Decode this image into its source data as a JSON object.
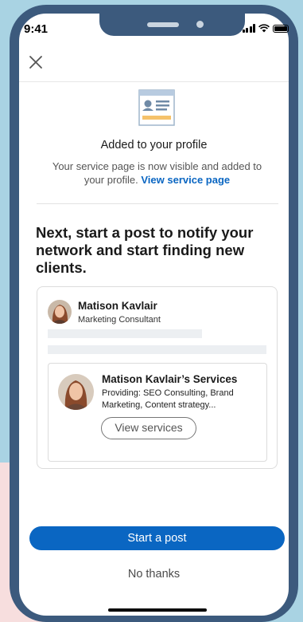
{
  "status_bar": {
    "time": "9:41"
  },
  "header": {
    "close_icon": "close-icon"
  },
  "confirmation": {
    "icon": "profile-card-icon",
    "title": "Added to your profile",
    "description": "Your service page is now visible and added to your profile.",
    "link": "View service page"
  },
  "headline": "Next, start a post to notify your network and start finding new clients.",
  "post_preview": {
    "author_name": "Matison Kavlair",
    "author_title": "Marketing Consultant",
    "service": {
      "title": "Matison Kavlair’s Services",
      "description": "Providing: SEO Consulting, Brand Marketing, Content strategy...",
      "button": "View services"
    }
  },
  "actions": {
    "primary": "Start a post",
    "secondary": "No thanks"
  },
  "colors": {
    "accent": "#0a66c2",
    "frame": "#3c5a7d",
    "background": "#a9d3e3",
    "icon_yellow": "#f5c26b"
  }
}
